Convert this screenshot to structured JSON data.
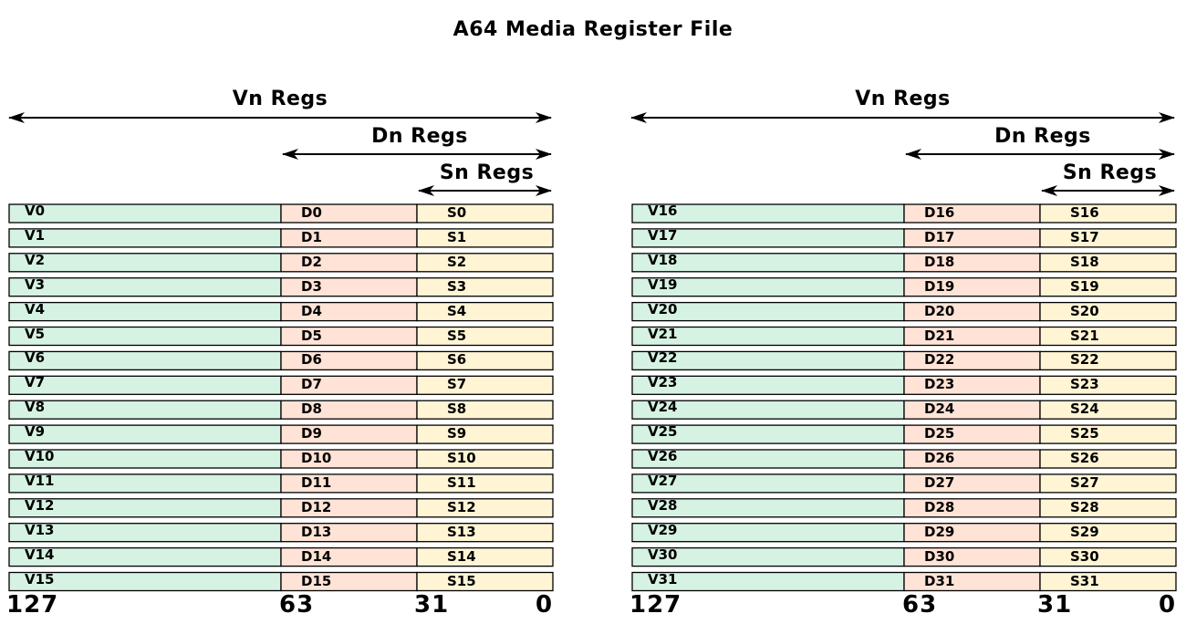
{
  "title": "A64 Media Register File",
  "span_labels": {
    "vn": "Vn Regs",
    "dn": "Dn Regs",
    "sn": "Sn Regs"
  },
  "bit_labels": [
    "127",
    "63",
    "31",
    "0"
  ],
  "colors": {
    "v_cell": "#d5f2e3",
    "d_cell": "#ffe3d6",
    "s_cell": "#fff5d5",
    "border": "#000000"
  },
  "panels": [
    {
      "rows": [
        {
          "v": "V0",
          "d": "D0",
          "s": "S0"
        },
        {
          "v": "V1",
          "d": "D1",
          "s": "S1"
        },
        {
          "v": "V2",
          "d": "D2",
          "s": "S2"
        },
        {
          "v": "V3",
          "d": "D3",
          "s": "S3"
        },
        {
          "v": "V4",
          "d": "D4",
          "s": "S4"
        },
        {
          "v": "V5",
          "d": "D5",
          "s": "S5"
        },
        {
          "v": "V6",
          "d": "D6",
          "s": "S6"
        },
        {
          "v": "V7",
          "d": "D7",
          "s": "S7"
        },
        {
          "v": "V8",
          "d": "D8",
          "s": "S8"
        },
        {
          "v": "V9",
          "d": "D9",
          "s": "S9"
        },
        {
          "v": "V10",
          "d": "D10",
          "s": "S10"
        },
        {
          "v": "V11",
          "d": "D11",
          "s": "S11"
        },
        {
          "v": "V12",
          "d": "D12",
          "s": "S12"
        },
        {
          "v": "V13",
          "d": "D13",
          "s": "S13"
        },
        {
          "v": "V14",
          "d": "D14",
          "s": "S14"
        },
        {
          "v": "V15",
          "d": "D15",
          "s": "S15"
        }
      ]
    },
    {
      "rows": [
        {
          "v": "V16",
          "d": "D16",
          "s": "S16"
        },
        {
          "v": "V17",
          "d": "D17",
          "s": "S17"
        },
        {
          "v": "V18",
          "d": "D18",
          "s": "S18"
        },
        {
          "v": "V19",
          "d": "D19",
          "s": "S19"
        },
        {
          "v": "V20",
          "d": "D20",
          "s": "S20"
        },
        {
          "v": "V21",
          "d": "D21",
          "s": "S21"
        },
        {
          "v": "V22",
          "d": "D22",
          "s": "S22"
        },
        {
          "v": "V23",
          "d": "D23",
          "s": "S23"
        },
        {
          "v": "V24",
          "d": "D24",
          "s": "S24"
        },
        {
          "v": "V25",
          "d": "D25",
          "s": "S25"
        },
        {
          "v": "V26",
          "d": "D26",
          "s": "S26"
        },
        {
          "v": "V27",
          "d": "D27",
          "s": "S27"
        },
        {
          "v": "V28",
          "d": "D28",
          "s": "S28"
        },
        {
          "v": "V29",
          "d": "D29",
          "s": "S29"
        },
        {
          "v": "V30",
          "d": "D30",
          "s": "S30"
        },
        {
          "v": "V31",
          "d": "D31",
          "s": "S31"
        }
      ]
    }
  ]
}
